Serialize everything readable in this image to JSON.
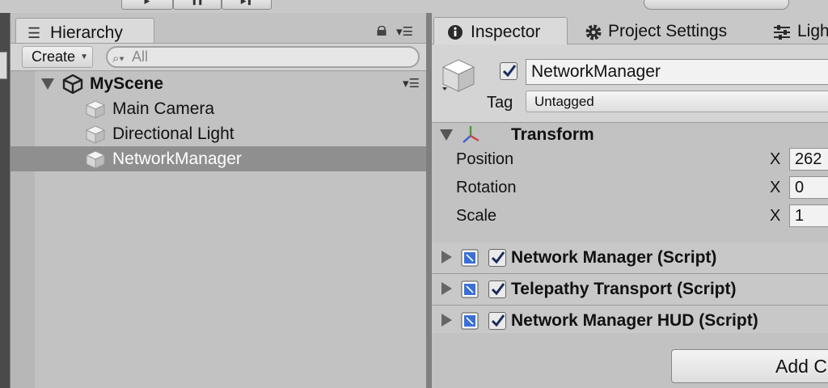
{
  "hierarchy": {
    "tab_label": "Hierarchy",
    "create_label": "Create",
    "search_placeholder": "All",
    "scene_name": "MyScene",
    "items": [
      {
        "label": "Main Camera"
      },
      {
        "label": "Directional Light"
      },
      {
        "label": "NetworkManager",
        "selected": true
      }
    ]
  },
  "inspector": {
    "tabs": [
      {
        "label": "Inspector",
        "icon": "info-icon"
      },
      {
        "label": "Project Settings",
        "icon": "gear-icon"
      },
      {
        "label": "Ligh",
        "icon": "sliders-icon"
      }
    ],
    "object_name": "NetworkManager",
    "active": true,
    "tag_label": "Tag",
    "tag_value": "Untagged",
    "transform": {
      "title": "Transform",
      "rows": [
        {
          "label": "Position",
          "axis": "X",
          "value": "262"
        },
        {
          "label": "Rotation",
          "axis": "X",
          "value": "0"
        },
        {
          "label": "Scale",
          "axis": "X",
          "value": "1"
        }
      ]
    },
    "components": [
      {
        "label": "Network Manager (Script)",
        "enabled": true
      },
      {
        "label": "Telepathy Transport (Script)",
        "enabled": true
      },
      {
        "label": "Network Manager HUD (Script)",
        "enabled": true
      }
    ],
    "add_component_label": "Add C"
  },
  "colors": {
    "selection": "#8f8f8f",
    "panel": "#c2c2c2",
    "script_icon": "#3a6fd8"
  }
}
